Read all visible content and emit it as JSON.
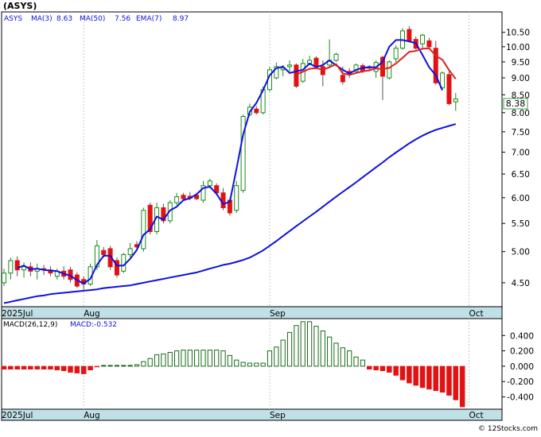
{
  "title": "(ASYS)",
  "watermark": "© 12Stocks.com",
  "indicators": {
    "symbol": "ASYS",
    "ma3_label": "MA(3)",
    "ma3_value": "8.63",
    "ma50_label": "MA(50)",
    "ma50_value": "7.56",
    "ema7_label": "EMA(7)",
    "ema7_value": "8.97",
    "last_price": "8.38"
  },
  "macd": {
    "label": "MACD(26,12,9)",
    "value_label": "MACD:-0.532"
  },
  "x_axis": {
    "ticks": [
      {
        "label": "2025Jul",
        "index": 0
      },
      {
        "label": "Aug",
        "index": 12
      },
      {
        "label": "Sep",
        "index": 40
      },
      {
        "label": "Oct",
        "index": 70
      }
    ]
  },
  "colors": {
    "up": "#1a8a1a",
    "down": "#e21212",
    "ma_blue": "#1010e0",
    "ema_red": "#e02020",
    "axis_band": "#bfe0e6",
    "price_box": "#3ca04a"
  },
  "chart_data": [
    {
      "type": "candlestick",
      "title": "(ASYS)",
      "y_scale": "log",
      "ylim": [
        4.15,
        11.25
      ],
      "y_ticks": [
        4.5,
        5.0,
        5.5,
        6.0,
        6.5,
        7.0,
        7.5,
        8.0,
        8.5,
        9.0,
        9.5,
        10.0,
        10.5
      ],
      "y_tick_labels": [
        "4.50",
        "5.00",
        "5.50",
        "6.00",
        "6.50",
        "7.00",
        "7.50",
        "8.00",
        "8.50",
        "9.00",
        "9.50",
        "10.00",
        "10.50"
      ],
      "ohlc": [
        [
          4.5,
          4.72,
          4.45,
          4.65
        ],
        [
          4.65,
          4.9,
          4.55,
          4.85
        ],
        [
          4.85,
          4.92,
          4.6,
          4.7
        ],
        [
          4.7,
          4.82,
          4.58,
          4.75
        ],
        [
          4.75,
          4.82,
          4.6,
          4.68
        ],
        [
          4.68,
          4.8,
          4.55,
          4.72
        ],
        [
          4.72,
          4.78,
          4.62,
          4.7
        ],
        [
          4.7,
          4.76,
          4.6,
          4.65
        ],
        [
          4.6,
          4.72,
          4.55,
          4.68
        ],
        [
          4.68,
          4.76,
          4.55,
          4.6
        ],
        [
          4.7,
          4.75,
          4.5,
          4.55
        ],
        [
          4.62,
          4.66,
          4.42,
          4.45
        ],
        [
          4.55,
          4.6,
          4.4,
          4.48
        ],
        [
          4.48,
          4.8,
          4.45,
          4.75
        ],
        [
          4.75,
          5.2,
          4.7,
          5.1
        ],
        [
          5.02,
          5.08,
          4.9,
          4.95
        ],
        [
          5.05,
          5.1,
          4.7,
          4.75
        ],
        [
          4.85,
          4.9,
          4.58,
          4.62
        ],
        [
          4.68,
          4.98,
          4.65,
          4.95
        ],
        [
          4.95,
          5.15,
          4.9,
          5.05
        ],
        [
          5.12,
          5.18,
          5.02,
          5.08
        ],
        [
          5.05,
          5.8,
          5.0,
          5.75
        ],
        [
          5.85,
          5.9,
          5.3,
          5.35
        ],
        [
          5.35,
          5.9,
          5.3,
          5.8
        ],
        [
          5.8,
          5.88,
          5.5,
          5.55
        ],
        [
          5.55,
          5.95,
          5.5,
          5.9
        ],
        [
          5.9,
          6.1,
          5.85,
          6.02
        ],
        [
          6.05,
          6.1,
          5.95,
          5.98
        ],
        [
          6.03,
          6.12,
          5.95,
          5.99
        ],
        [
          6.05,
          6.1,
          5.95,
          5.98
        ],
        [
          5.95,
          6.35,
          5.9,
          6.25
        ],
        [
          6.25,
          6.4,
          6.2,
          6.35
        ],
        [
          6.25,
          6.3,
          6.05,
          6.1
        ],
        [
          6.1,
          6.2,
          5.75,
          5.8
        ],
        [
          5.95,
          6.0,
          5.65,
          5.7
        ],
        [
          5.75,
          6.35,
          5.7,
          6.25
        ],
        [
          6.15,
          7.95,
          6.1,
          7.9
        ],
        [
          7.95,
          8.25,
          7.9,
          8.15
        ],
        [
          8.1,
          8.18,
          7.95,
          8.0
        ],
        [
          8.0,
          8.75,
          7.95,
          8.65
        ],
        [
          8.65,
          9.35,
          8.6,
          9.25
        ],
        [
          9.0,
          9.48,
          8.95,
          9.35
        ],
        [
          9.25,
          9.4,
          9.05,
          9.3
        ],
        [
          9.35,
          9.55,
          9.2,
          9.4
        ],
        [
          9.4,
          9.45,
          8.7,
          8.75
        ],
        [
          8.9,
          9.6,
          8.85,
          9.45
        ],
        [
          9.45,
          9.7,
          9.4,
          9.55
        ],
        [
          9.62,
          9.68,
          9.3,
          9.35
        ],
        [
          9.35,
          9.55,
          8.75,
          9.1
        ],
        [
          9.4,
          10.25,
          9.3,
          9.55
        ],
        [
          9.55,
          9.8,
          9.5,
          9.75
        ],
        [
          9.08,
          9.35,
          8.8,
          8.88
        ],
        [
          9.2,
          9.3,
          9.0,
          9.12
        ],
        [
          9.2,
          9.45,
          9.15,
          9.4
        ],
        [
          9.38,
          9.45,
          9.15,
          9.22
        ],
        [
          9.35,
          9.4,
          9.2,
          9.3
        ],
        [
          9.2,
          9.55,
          9.0,
          9.48
        ],
        [
          9.65,
          9.7,
          8.35,
          9.05
        ],
        [
          9.0,
          9.55,
          8.95,
          9.5
        ],
        [
          9.6,
          10.05,
          9.5,
          9.95
        ],
        [
          9.95,
          10.65,
          9.9,
          10.55
        ],
        [
          10.6,
          10.72,
          10.15,
          10.2
        ],
        [
          10.25,
          10.35,
          9.9,
          9.95
        ],
        [
          10.1,
          10.45,
          9.95,
          10.4
        ],
        [
          10.2,
          10.3,
          9.95,
          10.0
        ],
        [
          9.95,
          10.2,
          8.8,
          8.85
        ],
        [
          8.7,
          9.2,
          8.75,
          9.15
        ],
        [
          9.1,
          9.25,
          8.2,
          8.25
        ],
        [
          8.3,
          8.55,
          8.05,
          8.38
        ]
      ],
      "series": [
        {
          "name": "MA(50)",
          "color": "#1010e0",
          "start": 0,
          "values": [
            4.2,
            4.22,
            4.24,
            4.26,
            4.28,
            4.3,
            4.31,
            4.33,
            4.34,
            4.35,
            4.36,
            4.37,
            4.38,
            4.39,
            4.4,
            4.42,
            4.43,
            4.44,
            4.45,
            4.46,
            4.48,
            4.5,
            4.52,
            4.54,
            4.56,
            4.58,
            4.6,
            4.62,
            4.64,
            4.66,
            4.69,
            4.72,
            4.75,
            4.78,
            4.8,
            4.83,
            4.86,
            4.9,
            4.96,
            5.02,
            5.1,
            5.18,
            5.27,
            5.36,
            5.45,
            5.54,
            5.63,
            5.72,
            5.82,
            5.92,
            6.02,
            6.12,
            6.22,
            6.32,
            6.43,
            6.54,
            6.65,
            6.76,
            6.88,
            6.99,
            7.1,
            7.21,
            7.31,
            7.4,
            7.48,
            7.55,
            7.6,
            7.65,
            7.7
          ]
        },
        {
          "name": "MA(3)",
          "color": "#1010e0",
          "start": 2,
          "values": [
            4.73,
            4.77,
            4.71,
            4.72,
            4.7,
            4.69,
            4.68,
            4.64,
            4.61,
            4.54,
            4.49,
            4.56,
            4.78,
            4.93,
            4.93,
            4.77,
            4.77,
            4.88,
            5.03,
            5.29,
            5.39,
            5.63,
            5.57,
            5.75,
            5.82,
            5.95,
            5.99,
            6.07,
            6.2,
            6.23,
            6.08,
            5.87,
            5.92,
            6.62,
            7.43,
            8.02,
            8.27,
            8.63,
            9.08,
            9.3,
            9.35,
            9.15,
            9.2,
            9.25,
            9.45,
            9.33,
            9.4,
            9.55,
            9.39,
            9.25,
            9.13,
            9.25,
            9.31,
            9.33,
            9.33,
            9.5,
            10.0,
            10.23,
            10.23,
            10.18,
            10.12,
            9.73,
            9.33,
            9.08,
            8.63
          ]
        },
        {
          "name": "EMA(7)",
          "color": "#e02020",
          "start": 44,
          "values": [
            9.1,
            9.19,
            9.28,
            9.3,
            9.25,
            9.33,
            9.43,
            9.14,
            9.09,
            9.15,
            9.2,
            9.23,
            9.29,
            9.27,
            9.31,
            9.45,
            9.63,
            9.83,
            9.86,
            9.93,
            9.95,
            9.7,
            9.57,
            9.24,
            8.97
          ]
        }
      ]
    },
    {
      "type": "bar",
      "title": "MACD(26,12,9)",
      "ylim": [
        -0.56,
        0.62
      ],
      "y_ticks": [
        -0.4,
        -0.2,
        0.0,
        0.2,
        0.4
      ],
      "y_tick_labels": [
        "-0.400",
        "-0.200",
        "0.000",
        "0.200",
        "0.400"
      ],
      "values": [
        -0.04,
        -0.04,
        -0.04,
        -0.04,
        -0.04,
        -0.04,
        -0.04,
        -0.04,
        -0.05,
        -0.06,
        -0.08,
        -0.09,
        -0.1,
        -0.05,
        -0.01,
        0.0,
        0.0,
        0.0,
        0.0,
        0.0,
        0.02,
        0.06,
        0.1,
        0.15,
        0.16,
        0.18,
        0.2,
        0.21,
        0.21,
        0.21,
        0.21,
        0.21,
        0.21,
        0.2,
        0.14,
        0.08,
        0.05,
        0.04,
        0.04,
        0.04,
        0.2,
        0.25,
        0.34,
        0.44,
        0.53,
        0.58,
        0.58,
        0.52,
        0.46,
        0.38,
        0.3,
        0.24,
        0.2,
        0.12,
        0.08,
        -0.04,
        -0.05,
        -0.06,
        -0.08,
        -0.12,
        -0.18,
        -0.22,
        -0.25,
        -0.28,
        -0.3,
        -0.32,
        -0.34,
        -0.38,
        -0.44,
        -0.53
      ]
    }
  ]
}
